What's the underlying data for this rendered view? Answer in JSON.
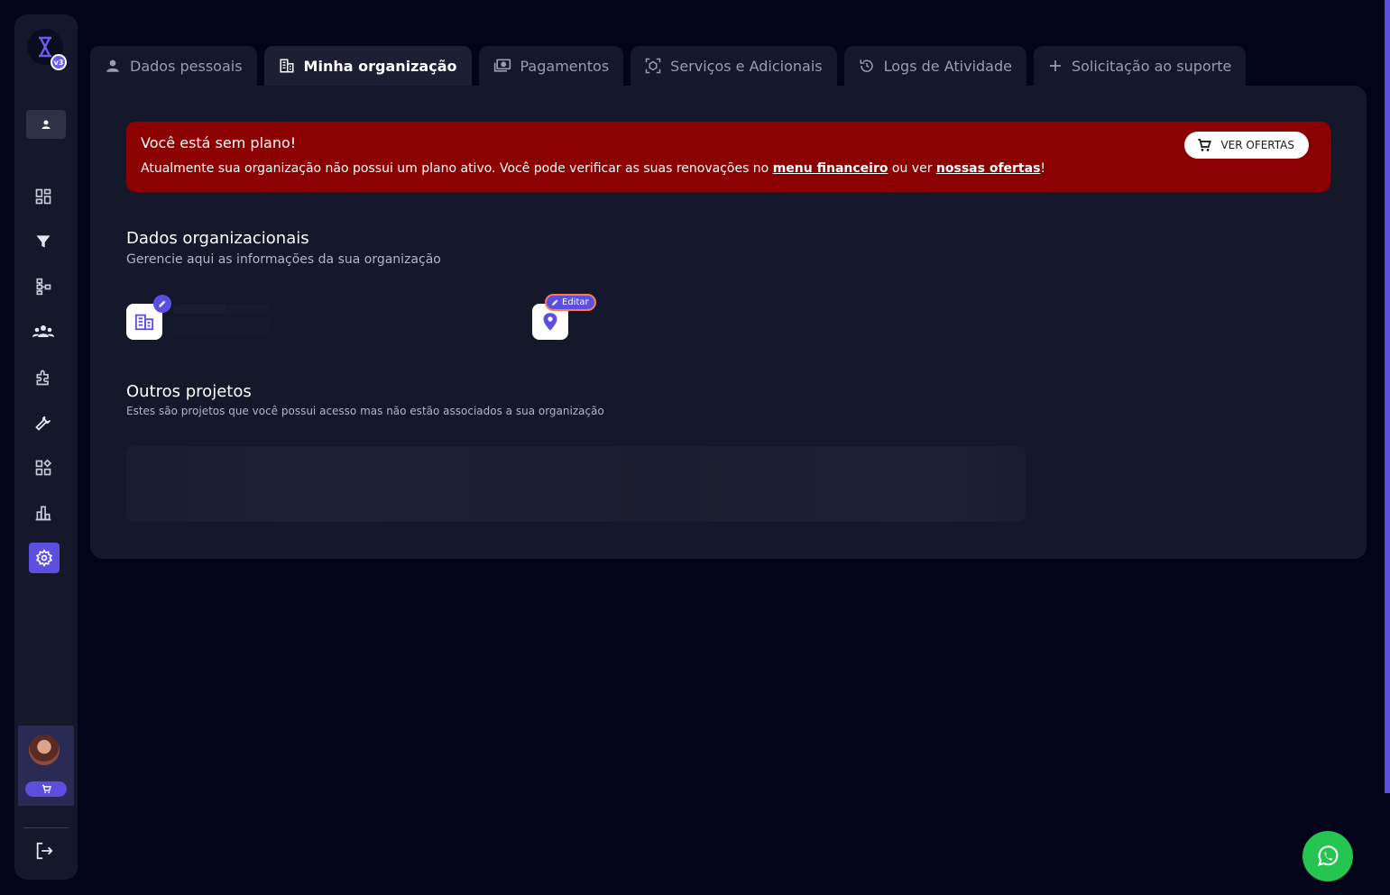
{
  "app": {
    "logo_badge": "v3",
    "accent_color": "#5b4fe0",
    "alert_color": "#8b0000"
  },
  "sidebar": {
    "items": [
      {
        "icon": "dashboard-icon"
      },
      {
        "icon": "filter-icon"
      },
      {
        "icon": "flowchart-icon"
      },
      {
        "icon": "team-icon"
      },
      {
        "icon": "puzzle-icon"
      },
      {
        "icon": "wrench-icon"
      },
      {
        "icon": "apps-icon"
      },
      {
        "icon": "bar-chart-icon"
      },
      {
        "icon": "settings-icon",
        "active": true
      }
    ]
  },
  "tabs": [
    {
      "label": "Dados pessoais",
      "icon": "person-icon"
    },
    {
      "label": "Minha organização",
      "icon": "building-icon",
      "active": true
    },
    {
      "label": "Pagamentos",
      "icon": "payments-icon"
    },
    {
      "label": "Serviços e Adicionais",
      "icon": "services-icon"
    },
    {
      "label": "Logs de Atividade",
      "icon": "history-icon"
    },
    {
      "label": "Solicitação ao suporte",
      "icon": "plus-icon"
    }
  ],
  "alert": {
    "title": "Você está sem plano!",
    "text_before": "Atualmente sua organização não possui um plano ativo. Você pode verificar as suas renovações no ",
    "link1": "menu financeiro",
    "text_middle": " ou ver ",
    "link2": "nossas ofertas",
    "text_after": "!",
    "button_label": "VER OFERTAS"
  },
  "org_section": {
    "title": "Dados organizacionais",
    "subtitle": "Gerencie aqui as informações da sua organização",
    "edit_label": "Editar"
  },
  "projects_section": {
    "title": "Outros projetos",
    "subtitle": "Estes são projetos que você possui acesso mas não estão associados a sua organização"
  }
}
